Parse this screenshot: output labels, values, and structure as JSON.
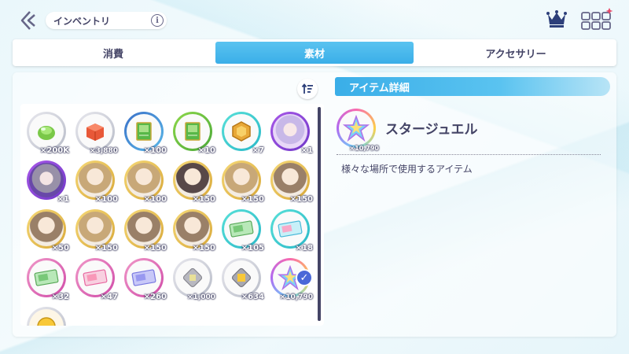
{
  "header": {
    "title": "インベントリ",
    "info_label": "i"
  },
  "tabs": [
    {
      "label": "消費",
      "active": false
    },
    {
      "label": "素材",
      "active": true
    },
    {
      "label": "アクセサリー",
      "active": false
    }
  ],
  "inventory": {
    "items": [
      {
        "count": "×200K",
        "ring": "silver",
        "inner": "white",
        "icon": "green-gem-icon"
      },
      {
        "count": "×3,880",
        "ring": "silver",
        "inner": "white",
        "icon": "red-box-icon"
      },
      {
        "count": "×100",
        "ring": "blue",
        "inner": "white",
        "icon": "green-book-icon"
      },
      {
        "count": "×10",
        "ring": "green",
        "inner": "white",
        "icon": "green-book-icon"
      },
      {
        "count": "×7",
        "ring": "teal",
        "inner": "white",
        "icon": "gold-hexagon-icon"
      },
      {
        "count": "×1",
        "ring": "purple",
        "inner": "chara-purple",
        "icon": "character-portrait"
      },
      {
        "count": "×1",
        "ring": "purple",
        "inner": "chara-dark",
        "icon": "character-portrait"
      },
      {
        "count": "×100",
        "ring": "gold",
        "inner": "face2",
        "icon": "character-portrait"
      },
      {
        "count": "×100",
        "ring": "gold",
        "inner": "face2",
        "icon": "character-portrait"
      },
      {
        "count": "×150",
        "ring": "gold",
        "inner": "face3",
        "icon": "character-portrait"
      },
      {
        "count": "×150",
        "ring": "gold",
        "inner": "face2",
        "icon": "character-portrait"
      },
      {
        "count": "×150",
        "ring": "gold",
        "inner": "face",
        "icon": "character-portrait"
      },
      {
        "count": "×50",
        "ring": "gold",
        "inner": "face",
        "icon": "character-portrait"
      },
      {
        "count": "×150",
        "ring": "gold",
        "inner": "face2",
        "icon": "character-portrait"
      },
      {
        "count": "×150",
        "ring": "gold",
        "inner": "face",
        "icon": "character-portrait"
      },
      {
        "count": "×150",
        "ring": "gold",
        "inner": "face",
        "icon": "character-portrait"
      },
      {
        "count": "×105",
        "ring": "teal",
        "inner": "white",
        "icon": "green-ticket-icon"
      },
      {
        "count": "×18",
        "ring": "teal",
        "inner": "white",
        "icon": "cyan-ticket-icon"
      },
      {
        "count": "×32",
        "ring": "pink",
        "inner": "white",
        "icon": "green-ticket-icon"
      },
      {
        "count": "×47",
        "ring": "pink",
        "inner": "white",
        "icon": "pink-ticket-icon"
      },
      {
        "count": "×260",
        "ring": "pink",
        "inner": "white",
        "icon": "purple-ticket-icon"
      },
      {
        "count": "×1,000",
        "ring": "silver",
        "inner": "white",
        "icon": "silver-chip-icon"
      },
      {
        "count": "×634",
        "ring": "silver",
        "inner": "white",
        "icon": "gold-chip-icon"
      },
      {
        "count": "×10,790",
        "ring": "star",
        "inner": "white",
        "icon": "star-jewel-icon",
        "selected": true
      },
      {
        "count": "",
        "ring": "silver",
        "inner": "cream",
        "icon": "gold-coin-icon"
      }
    ]
  },
  "detail": {
    "header": "アイテム詳細",
    "name": "スタージュエル",
    "count": "×10,790",
    "description": "様々な場所で使用するアイテム"
  }
}
